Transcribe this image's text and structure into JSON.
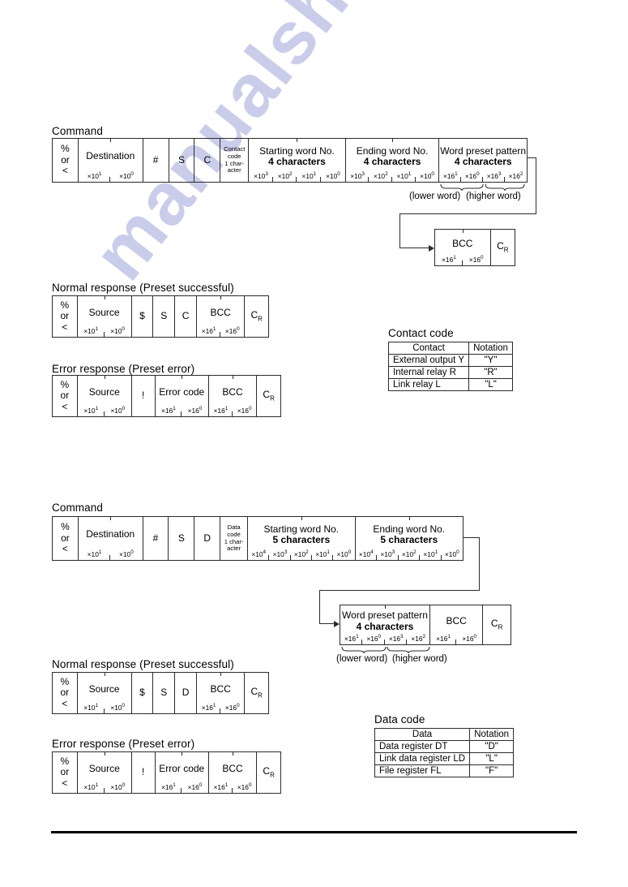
{
  "watermark": {
    "text": "manualshive.com"
  },
  "sections": {
    "block1": {
      "command_title": "Command",
      "normal_title": "Normal response (Preset successful)",
      "error_title": "Error response (Preset error)",
      "command_cells": {
        "start": "% or <",
        "start_l1": "%",
        "start_l2": "or",
        "start_l3": "<",
        "destination": "Destination",
        "destination_subs": [
          "×10",
          "×10"
        ],
        "hash": "#",
        "s": "S",
        "c": "C",
        "contact_code_l1": "Contact",
        "contact_code_l2": "code",
        "contact_code_l3": "1 char-",
        "contact_code_l4": "acter",
        "starting_word_l1": "Starting word No.",
        "starting_word_l2": "4 characters",
        "ending_word_l1": "Ending word No.",
        "ending_word_l2": "4 characters",
        "preset_pattern_l1": "Word preset pattern",
        "preset_pattern_l2": "4 characters"
      },
      "exponents": {
        "d1": "×10",
        "d1s": "1",
        "d0": "×10",
        "d0s": "0",
        "h1": "×16",
        "h1s": "1",
        "h0": "×16",
        "h0s": "0",
        "h3": "×16",
        "h3s": "3",
        "h2": "×16",
        "h2s": "2",
        "e3": "×10",
        "e3s": "3",
        "e2": "×10",
        "e2s": "2"
      },
      "lower_word": "(lower word)",
      "higher_word": "(higher word)",
      "bcc": "BCC",
      "cr": "C",
      "cr_sub": "R",
      "normal_cells": {
        "source": "Source",
        "dollar": "$",
        "s": "S",
        "c": "C",
        "bcc": "BCC"
      },
      "error_cells": {
        "source": "Source",
        "bang": "!",
        "error_code": "Error code",
        "bcc": "BCC"
      }
    },
    "block2": {
      "command_title": "Command",
      "normal_title": "Normal response (Preset successful)",
      "error_title": "Error response (Preset error)",
      "command_cells": {
        "start_l1": "%",
        "start_l2": "or",
        "start_l3": "<",
        "destination": "Destination",
        "hash": "#",
        "s": "S",
        "d": "D",
        "data_code_l1": "Data",
        "data_code_l2": "code",
        "data_code_l3": "1 char-",
        "data_code_l4": "acter",
        "starting_word_l1": "Starting word No.",
        "starting_word_l2": "5 characters",
        "ending_word_l1": "Ending word No.",
        "ending_word_l2": "5 characters",
        "preset_pattern_l1": "Word preset pattern",
        "preset_pattern_l2": "4 characters"
      },
      "exponents": {
        "e4": "×10",
        "e4s": "4",
        "e3": "×10",
        "e3s": "3",
        "e2": "×10",
        "e2s": "2",
        "e1": "×10",
        "e1s": "1",
        "e0": "×10",
        "e0s": "0"
      },
      "lower_word": "(lower word)",
      "higher_word": "(higher word)",
      "bcc": "BCC",
      "cr": "C",
      "cr_sub": "R",
      "normal_cells": {
        "source": "Source",
        "dollar": "$",
        "s": "S",
        "d": "D",
        "bcc": "BCC"
      },
      "error_cells": {
        "source": "Source",
        "bang": "!",
        "error_code": "Error code",
        "bcc": "BCC"
      }
    }
  },
  "contact_code_table": {
    "title": "Contact code",
    "headers": [
      "Contact",
      "Notation"
    ],
    "rows": [
      [
        "External output Y",
        "\"Y\""
      ],
      [
        "Internal relay R",
        "\"R\""
      ],
      [
        "Link relay L",
        "\"L\""
      ]
    ]
  },
  "data_code_table": {
    "title": "Data code",
    "headers": [
      "Data",
      "Notation"
    ],
    "rows": [
      [
        "Data register DT",
        "\"D\""
      ],
      [
        "Link data register LD",
        "\"L\""
      ],
      [
        "File register FL",
        "\"F\""
      ]
    ]
  }
}
